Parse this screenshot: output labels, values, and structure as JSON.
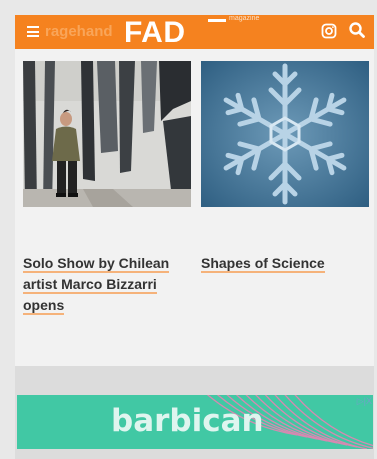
{
  "header": {
    "ghost_text": "ragehand",
    "logo": "FAD",
    "logo_sub": "magazine",
    "background": "#f5821f"
  },
  "articles": [
    {
      "title": "Solo Show by Chilean artist Marco Bizzarri opens",
      "image": "person-in-gallery"
    },
    {
      "title": "Shapes of Science",
      "image": "snowflake"
    }
  ],
  "ad": {
    "text": "barbican",
    "marker": "▷|X",
    "background": "#41c8a4"
  },
  "icons": [
    "menu-icon",
    "instagram-icon",
    "search-icon"
  ]
}
